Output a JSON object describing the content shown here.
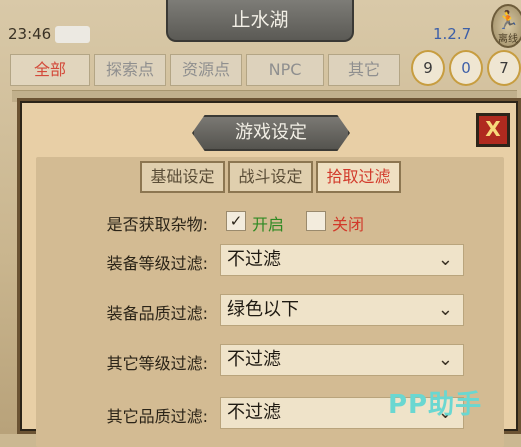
{
  "header": {
    "title": "止水湖",
    "time": "23:46",
    "version": "1.2.7",
    "gear_label": "离线"
  },
  "tabs": [
    {
      "label": "全部"
    },
    {
      "label": "探索点"
    },
    {
      "label": "资源点"
    },
    {
      "label": "NPC"
    },
    {
      "label": "其它"
    }
  ],
  "counters": [
    "9",
    "0",
    "7"
  ],
  "modal": {
    "title": "游戏设定",
    "close_label": "X",
    "subtabs": [
      {
        "label": "基础设定"
      },
      {
        "label": "战斗设定"
      },
      {
        "label": "拾取过滤"
      }
    ],
    "pickup_misc": {
      "label": "是否获取杂物:",
      "on_label": "开启",
      "off_label": "关闭",
      "check_mark": "✓"
    },
    "filters": [
      {
        "label": "装备等级过滤:",
        "value": "不过滤"
      },
      {
        "label": "装备品质过滤:",
        "value": "绿色以下"
      },
      {
        "label": "其它等级过滤:",
        "value": "不过滤"
      },
      {
        "label": "其它品质过滤:",
        "value": "不过滤"
      }
    ]
  },
  "watermark": "PP助手",
  "colors": {
    "accent_red": "#d23a2b",
    "on_green": "#2f8a23",
    "version_blue": "#3d5fa8",
    "close_red": "#b02a1f"
  },
  "icons": {
    "close": "close-icon",
    "chevron": "chevron-down-icon",
    "gear": "running-man-icon"
  }
}
